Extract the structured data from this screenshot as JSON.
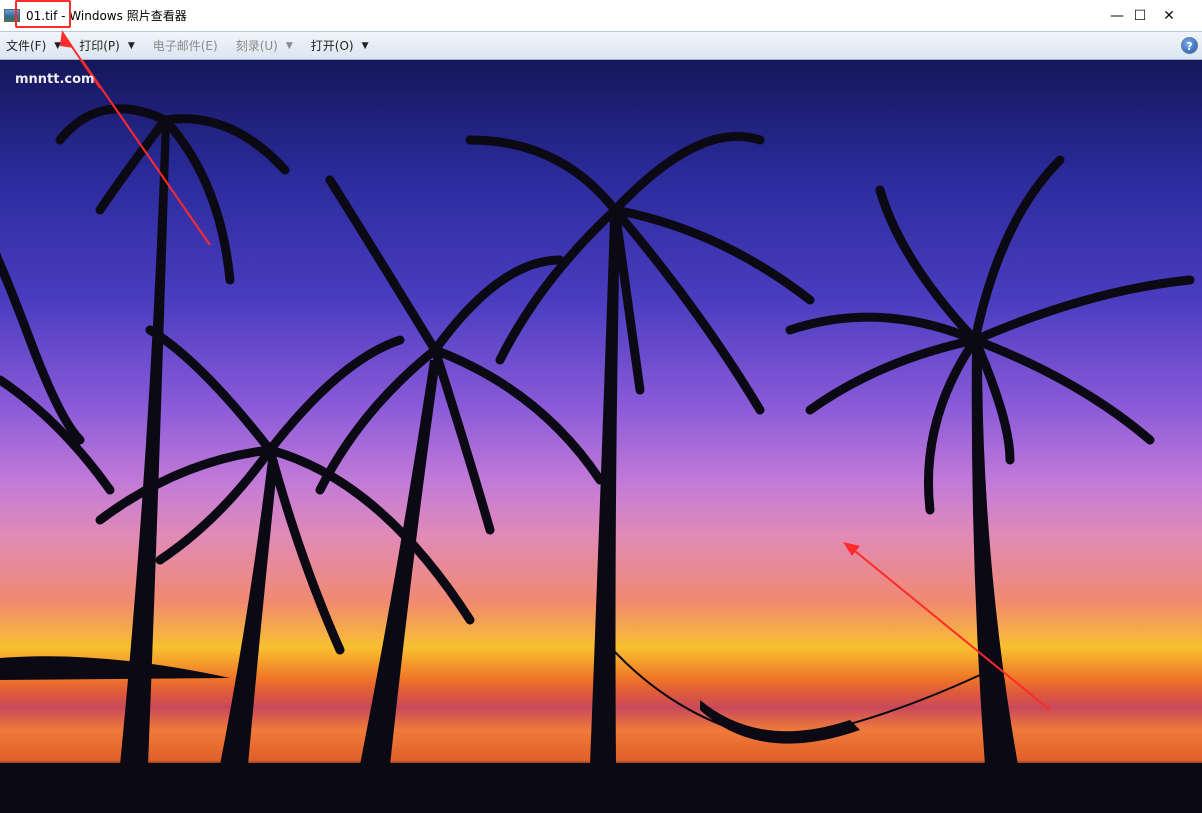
{
  "window": {
    "title": "01.tif - Windows 照片查看器",
    "minimize": "—",
    "maximize": "☐",
    "close": "✕"
  },
  "menu": [
    {
      "label": "文件(F)",
      "enabled": true
    },
    {
      "label": "打印(P)",
      "enabled": true
    },
    {
      "label": "电子邮件(E)",
      "enabled": false
    },
    {
      "label": "刻录(U)",
      "enabled": false
    },
    {
      "label": "打开(O)",
      "enabled": true
    }
  ],
  "help": "?",
  "photo": {
    "watermark": "mnntt.com"
  },
  "annotation_color": "#ff2a2a"
}
